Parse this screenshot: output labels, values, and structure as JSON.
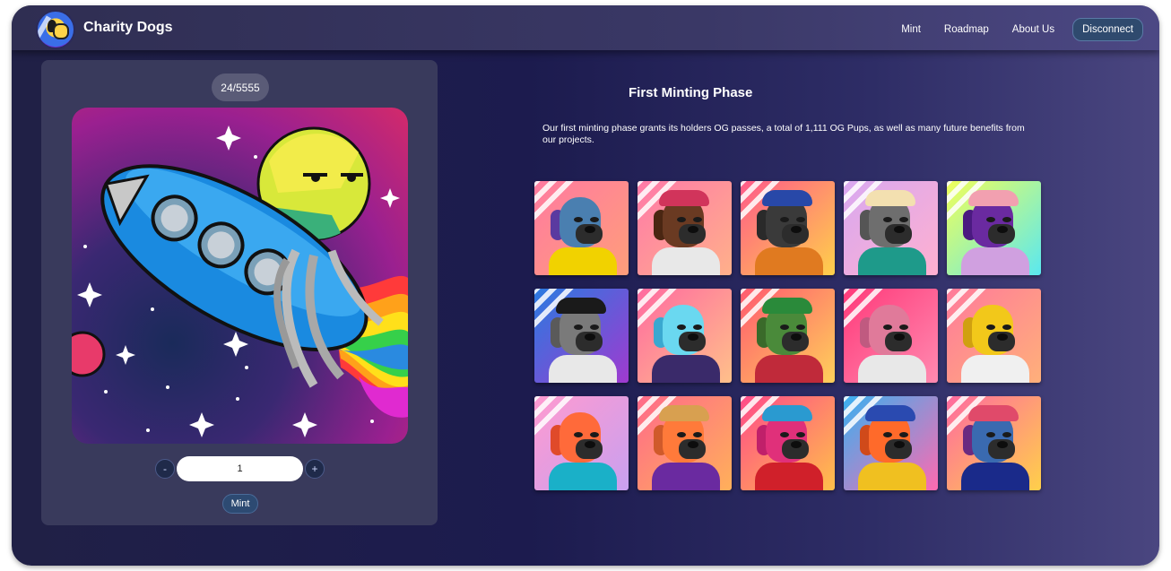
{
  "nav": {
    "brand": "Charity Dogs",
    "links": [
      "Mint",
      "Roadmap",
      "About Us"
    ],
    "disconnect_label": "Disconnect"
  },
  "mint_panel": {
    "counter": "24/5555",
    "quantity": "1",
    "minus_label": "-",
    "plus_label": "+",
    "mint_label": "Mint"
  },
  "phase": {
    "title": "First Minting Phase",
    "description": "Our first minting phase grants its holders OG passes, a total of 1,111 OG Pups, as well as many future benefits from our projects."
  },
  "colors": {
    "nav_bg": "#3a3866",
    "panel_bg": "#393a5c",
    "button_bg": "#2d4a72"
  },
  "gallery": [
    {
      "bg": "linear-gradient(135deg,#ff7aa0,#ff9e7a)",
      "fur": "#4a7fb0",
      "ear": "#5a3aa0",
      "body": "#f1d200",
      "hat": ""
    },
    {
      "bg": "linear-gradient(135deg,#ff7aa8,#ffb08a)",
      "fur": "#6a3a22",
      "ear": "#4a2612",
      "body": "#e8e8e8",
      "hat": "#d1345b"
    },
    {
      "bg": "linear-gradient(135deg,#ff5a8a,#ffd04a)",
      "fur": "#3a3a3a",
      "ear": "#2a2a2a",
      "body": "#e07a20",
      "hat": "#2848a8"
    },
    {
      "bg": "linear-gradient(135deg,#d8a8f0,#ffb0d0)",
      "fur": "#6e6e6e",
      "ear": "#555555",
      "body": "#1e9a8a",
      "hat": "#f3e0b0"
    },
    {
      "bg": "linear-gradient(135deg,#f0ff5a,#5ae8f0)",
      "fur": "#6a2aa0",
      "ear": "#4a1a80",
      "body": "#d0a0e0",
      "hat": "#f2a0b0"
    },
    {
      "bg": "linear-gradient(135deg,#2a7ae0,#a03ad0)",
      "fur": "#7a7a7a",
      "ear": "#5a5a5a",
      "body": "#e8e8e8",
      "hat": "#1a1a1a"
    },
    {
      "bg": "linear-gradient(135deg,#ff6aa0,#ffc08a)",
      "fur": "#6ad8f0",
      "ear": "#3aa8d0",
      "body": "#3a2a6a",
      "hat": ""
    },
    {
      "bg": "linear-gradient(135deg,#ff5a70,#ffd05a)",
      "fur": "#4a8a3a",
      "ear": "#3a6a2a",
      "body": "#c02a3a",
      "hat": "#2a8a3a"
    },
    {
      "bg": "linear-gradient(135deg,#ff3a7a,#ff8ab0)",
      "fur": "#e07a9a",
      "ear": "#c05a80",
      "body": "#e8e8e8",
      "hat": ""
    },
    {
      "bg": "linear-gradient(135deg,#ff7a9a,#ffb07a)",
      "fur": "#f2c81a",
      "ear": "#d0a010",
      "body": "#f0f0f0",
      "hat": ""
    },
    {
      "bg": "linear-gradient(135deg,#ff9ad0,#c8a0f0)",
      "fur": "#ff6a3a",
      "ear": "#e04a2a",
      "body": "#1ab0c8",
      "hat": ""
    },
    {
      "bg": "linear-gradient(135deg,#ff6a8a,#ffb05a)",
      "fur": "#ff7a3a",
      "ear": "#d05a2a",
      "body": "#6a2aa0",
      "hat": "#d8a050"
    },
    {
      "bg": "linear-gradient(135deg,#ff4a8a,#ffc04a)",
      "fur": "#e0307a",
      "ear": "#c0206a",
      "body": "#d0202a",
      "hat": "#2a9ad0"
    },
    {
      "bg": "linear-gradient(135deg,#3ab0f0,#ff6ab0)",
      "fur": "#ff6a2a",
      "ear": "#d04a1a",
      "body": "#f0c020",
      "hat": "#2a4ab0"
    },
    {
      "bg": "linear-gradient(135deg,#ff6aa0,#ffd04a)",
      "fur": "#3a6ab0",
      "ear": "#6a2a80",
      "body": "#1a2a8a",
      "hat": "#e04a6a"
    }
  ]
}
